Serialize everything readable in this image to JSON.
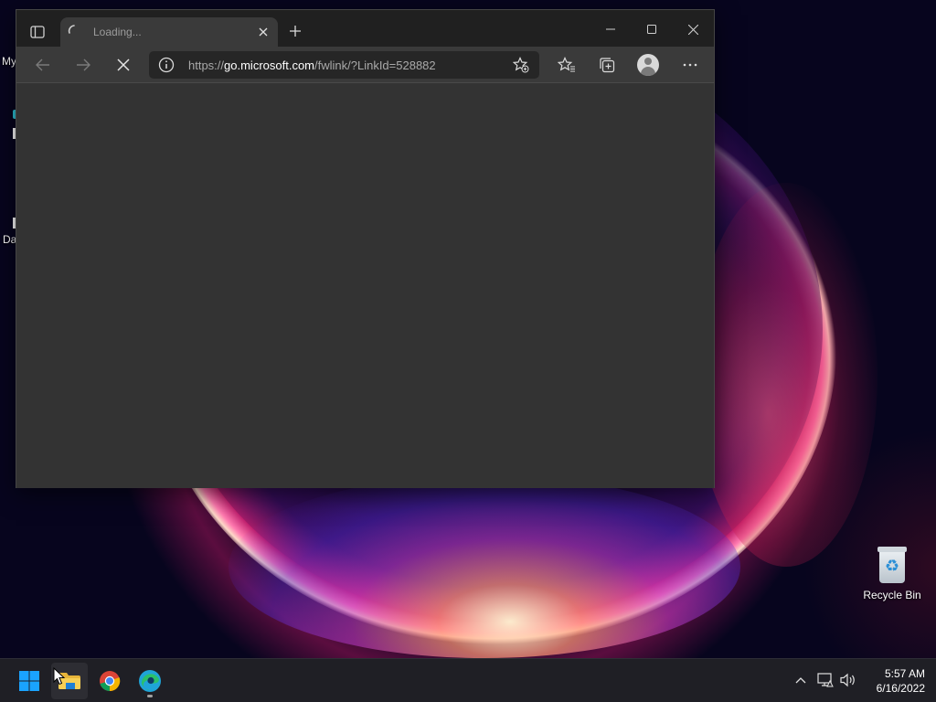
{
  "desktop": {
    "partial_labels": [
      "My",
      "Da"
    ],
    "recycle_bin": {
      "label": "Recycle Bin",
      "icon": "recycle-bin-icon"
    }
  },
  "browser": {
    "tab": {
      "title": "Loading...",
      "icon": "loading-spinner-icon"
    },
    "address": {
      "scheme": "https://",
      "host": "go.microsoft.com",
      "path": "/fwlink/?LinkId=528882",
      "icon": "info-icon"
    },
    "toolbar_icons": [
      "back-arrow-icon",
      "forward-arrow-icon",
      "stop-loading-icon",
      "add-favorite-icon",
      "favorites-icon",
      "collections-icon",
      "profile-icon",
      "more-icon"
    ],
    "window_controls": [
      "minimize-icon",
      "maximize-icon",
      "close-icon"
    ]
  },
  "taskbar": {
    "apps": [
      "start-icon",
      "file-explorer-icon",
      "chrome-icon",
      "edge-icon"
    ],
    "tray_icons": [
      "chevron-up-icon",
      "network-icon",
      "volume-icon"
    ],
    "clock": {
      "time": "5:57 AM",
      "date": "6/16/2022"
    }
  },
  "colors": {
    "window_bg": "#2f2f2f",
    "toolbar_bg": "#3a3a3a",
    "tabbar_bg": "#202020",
    "taskbar_bg": "#1f1f25",
    "edge_accent": "#1fa4d8",
    "windows_blue": "#1aa3ff"
  }
}
